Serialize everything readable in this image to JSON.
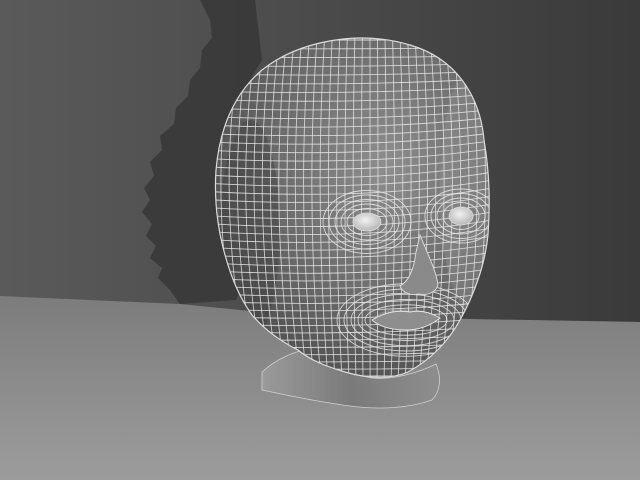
{
  "scene": {
    "subject": "wireframe-head-model",
    "colors": {
      "backdrop_dark": "#3d3d3d",
      "backdrop_light": "#5e5e5e",
      "floor_far": "#7a7a7a",
      "floor_near": "#9a9a9a",
      "shadow": "#383838",
      "skin_dark": "#4b4b4b",
      "skin_mid": "#6a6a6a",
      "skin_light": "#8c8c8c",
      "wire": "#e8e8e8",
      "neck": "#7c7c7c",
      "eye": "#d6d6d6"
    }
  }
}
